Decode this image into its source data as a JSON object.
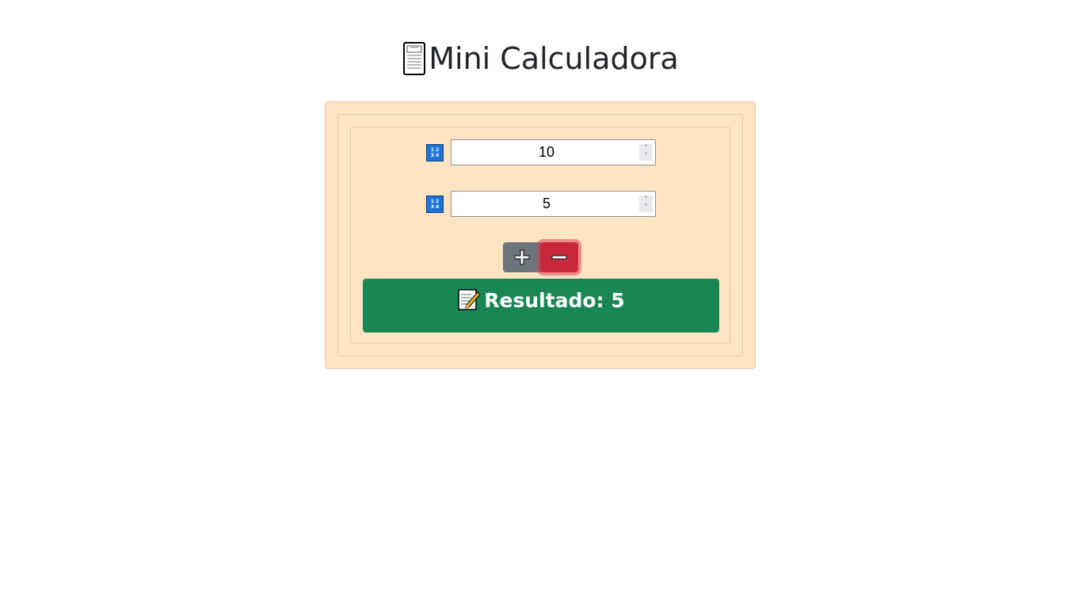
{
  "header": {
    "title": "Mini Calculadora",
    "icon": "calculator-icon"
  },
  "inputs": [
    {
      "icon": "numbers-icon",
      "value": "10"
    },
    {
      "icon": "numbers-icon",
      "value": "5"
    }
  ],
  "operations": {
    "plus_icon": "plus-icon",
    "minus_icon": "minus-icon",
    "active": "minus"
  },
  "result": {
    "icon": "memo-icon",
    "label": "Resultado: 5"
  },
  "colors": {
    "panel_bg": "#ffe4c4",
    "plus_button": "#6c757d",
    "minus_button": "#c8283a",
    "result_bg": "#198754",
    "number_icon": "#1e74d6"
  }
}
